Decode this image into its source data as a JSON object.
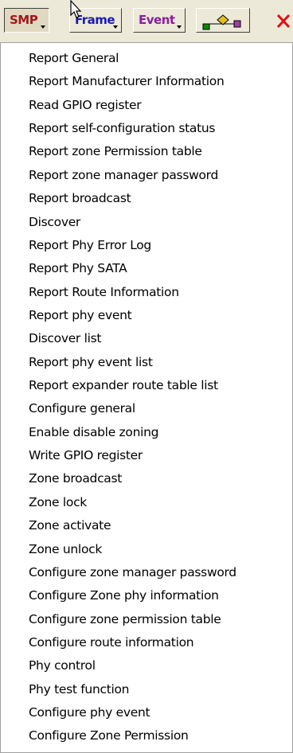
{
  "toolbar": {
    "smp_label": "SMP",
    "frame_label": "Frame",
    "event_label": "Event",
    "flow_icon": "flowchart-icon",
    "close_icon": "close-icon",
    "colors": {
      "smp": "#a01818",
      "frame": "#1a1ab0",
      "event": "#8a1ea0",
      "close": "#e01010"
    }
  },
  "menu": {
    "items": [
      "Report General",
      "Report Manufacturer Information",
      "Read GPIO register",
      "Report self-configuration status",
      "Report zone Permission table",
      "Report zone manager password",
      "Report broadcast",
      "Discover",
      "Report Phy Error Log",
      "Report Phy SATA",
      "Report Route Information",
      "Report phy event",
      "Discover list",
      "Report phy event list",
      "Report expander route table list",
      "Configure general",
      "Enable disable zoning",
      "Write GPIO register",
      "Zone broadcast",
      "Zone lock",
      "Zone activate",
      "Zone unlock",
      "Configure zone manager password",
      "Configure Zone phy information",
      "Configure zone permission table",
      "Configure route information",
      "Phy control",
      "Phy test function",
      "Configure phy event",
      "Configure Zone Permission"
    ]
  }
}
